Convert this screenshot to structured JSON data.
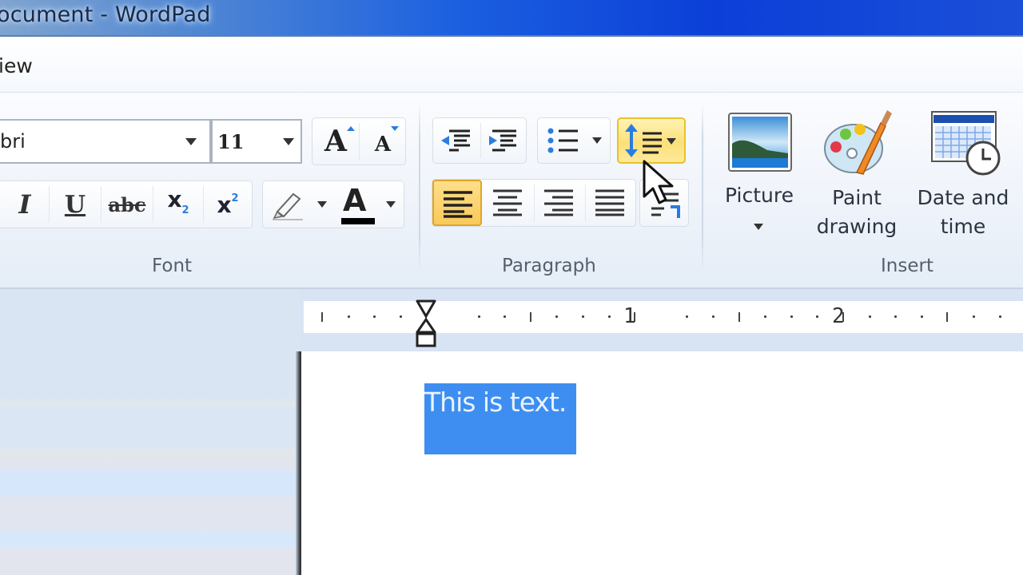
{
  "window": {
    "title": "ocument - WordPad",
    "accent": "#1b5fe0"
  },
  "tabs": {
    "view_label": "iew"
  },
  "ribbon": {
    "font_group": {
      "label": "Font",
      "font_name": "bri",
      "font_size": "11",
      "buttons": [
        {
          "name": "grow-font",
          "icon": "grow-font-icon"
        },
        {
          "name": "shrink-font",
          "icon": "shrink-font-icon"
        },
        {
          "name": "italic",
          "icon": "italic-icon"
        },
        {
          "name": "underline",
          "icon": "underline-icon"
        },
        {
          "name": "strikethrough",
          "icon": "strikethrough-icon"
        },
        {
          "name": "subscript",
          "icon": "subscript-icon"
        },
        {
          "name": "superscript",
          "icon": "superscript-icon"
        },
        {
          "name": "highlight",
          "icon": "highlighter-icon"
        },
        {
          "name": "font-color",
          "icon": "font-color-icon"
        }
      ],
      "glyphs": {
        "grow": "A",
        "shrink": "A",
        "italic": "I",
        "underline": "U",
        "strike": "abc",
        "sub_base": "x",
        "sub_script": "2",
        "sup_base": "x",
        "sup_script": "2",
        "font_color": "A"
      }
    },
    "paragraph_group": {
      "label": "Paragraph",
      "active_alignment": "left",
      "hovered_button": "line-spacing",
      "highlight_color": "#f7d44a"
    },
    "insert_group": {
      "label": "Insert",
      "items": [
        {
          "label_line1": "Picture",
          "label_line2": "",
          "icon": "picture-icon",
          "has_dropdown": true
        },
        {
          "label_line1": "Paint",
          "label_line2": "drawing",
          "icon": "paint-palette-icon",
          "has_dropdown": false
        },
        {
          "label_line1": "Date and",
          "label_line2": "time",
          "icon": "calendar-clock-icon",
          "has_dropdown": false
        }
      ]
    }
  },
  "ruler": {
    "numbers": [
      "1",
      "2"
    ]
  },
  "document": {
    "selected_text": "This is text.",
    "selection_color": "#3d8ef0"
  }
}
